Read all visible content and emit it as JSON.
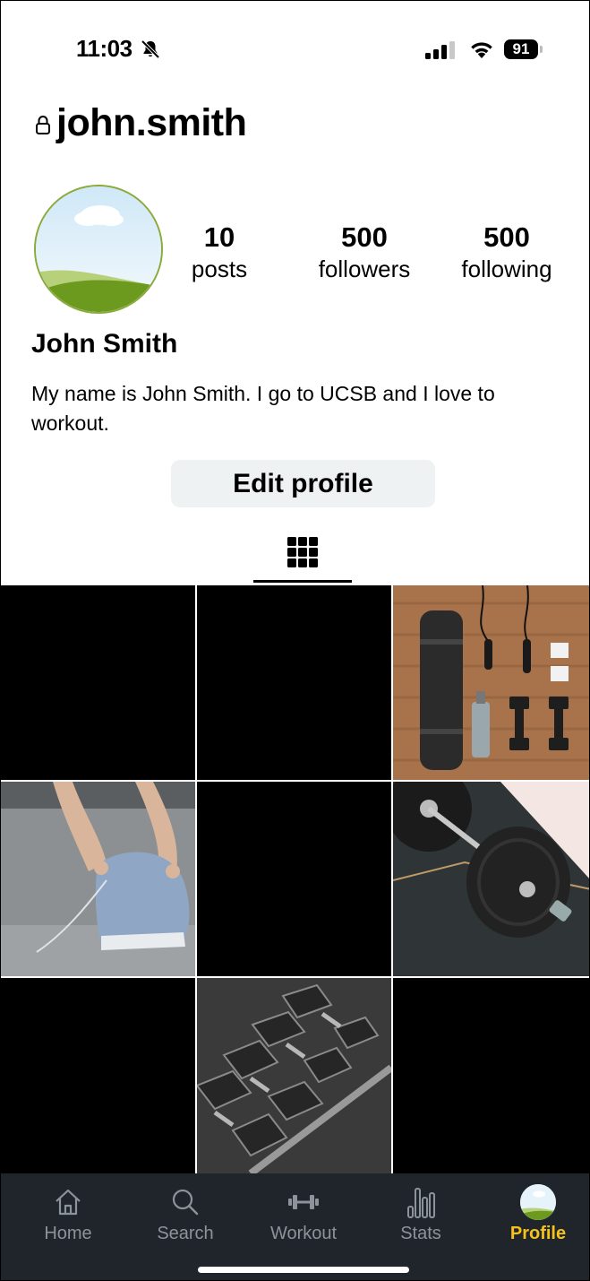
{
  "status_bar": {
    "time": "11:03",
    "battery": "91"
  },
  "profile": {
    "username": "john.smith",
    "full_name": "John Smith",
    "bio": "My name is John Smith. I go to UCSB and I love to workout.",
    "stats": {
      "posts": {
        "count": "10",
        "label": "posts"
      },
      "followers": {
        "count": "500",
        "label": "followers"
      },
      "following": {
        "count": "500",
        "label": "following"
      }
    },
    "edit_button": "Edit profile"
  },
  "tabbar": {
    "items": [
      {
        "label": "Home",
        "icon": "house-icon"
      },
      {
        "label": "Search",
        "icon": "magnifier-icon"
      },
      {
        "label": "Workout",
        "icon": "dumbbell-icon"
      },
      {
        "label": "Stats",
        "icon": "bar-chart-icon"
      },
      {
        "label": "Profile",
        "icon": "avatar"
      }
    ],
    "active_color": "#f4c21b",
    "inactive_color": "#8d939a"
  }
}
